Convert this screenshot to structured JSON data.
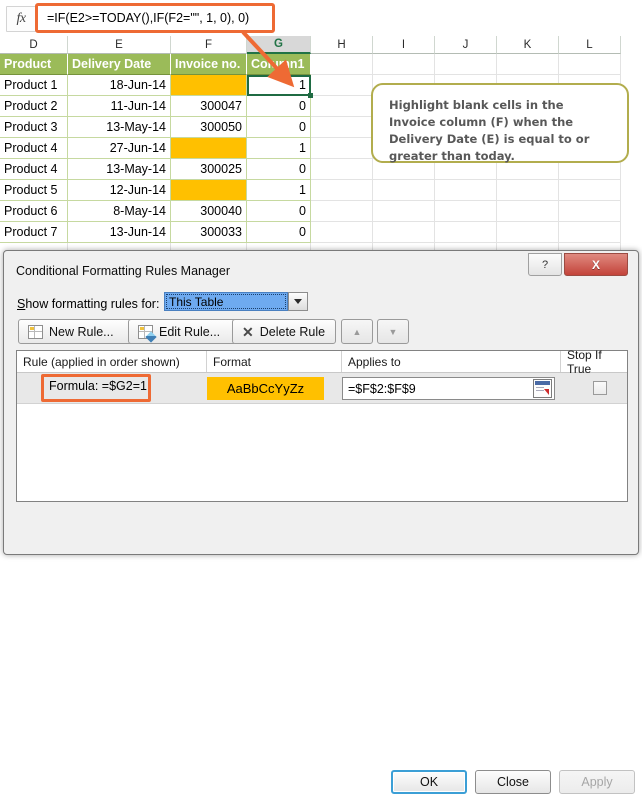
{
  "formula_bar": {
    "fx_icon": "fx-icon",
    "formula": "=IF(E2>=TODAY(),IF(F2=\"\", 1, 0), 0)"
  },
  "worksheet": {
    "column_letters": [
      "D",
      "E",
      "F",
      "G",
      "H",
      "I",
      "J",
      "K",
      "L"
    ],
    "selected_column": "G",
    "active_cell": "G2",
    "headers": [
      "Product",
      "Delivery Date",
      "Invoice no.",
      "Column1"
    ],
    "rows": [
      {
        "product": "Product 1",
        "date": "18-Jun-14",
        "invoice": "",
        "flag": "1",
        "invoice_filled": true
      },
      {
        "product": "Product 2",
        "date": "11-Jun-14",
        "invoice": "300047",
        "flag": "0",
        "invoice_filled": false
      },
      {
        "product": "Product 3",
        "date": "13-May-14",
        "invoice": "300050",
        "flag": "0",
        "invoice_filled": false
      },
      {
        "product": "Product 4",
        "date": "27-Jun-14",
        "invoice": "",
        "flag": "1",
        "invoice_filled": true
      },
      {
        "product": "Product 4",
        "date": "13-May-14",
        "invoice": "300025",
        "flag": "0",
        "invoice_filled": false
      },
      {
        "product": "Product 5",
        "date": "12-Jun-14",
        "invoice": "",
        "flag": "1",
        "invoice_filled": true
      },
      {
        "product": "Product 6",
        "date": "8-May-14",
        "invoice": "300040",
        "flag": "0",
        "invoice_filled": false
      },
      {
        "product": "Product 7",
        "date": "13-Jun-14",
        "invoice": "300033",
        "flag": "0",
        "invoice_filled": false
      }
    ]
  },
  "callout": {
    "text": "Highlight blank cells in the Invoice column (F) when the Delivery Date (E) is equal to or greater than today."
  },
  "dialog": {
    "title": "Conditional Formatting Rules Manager",
    "help_label": "?",
    "close_label": "X",
    "show_rules_label": "Show formatting rules for:",
    "scope_value": "This Table",
    "buttons": {
      "new_rule": "New Rule...",
      "edit_rule": "Edit Rule...",
      "delete_rule": "Delete Rule",
      "move_up": "▲",
      "move_down": "▼"
    },
    "grid_headers": [
      "Rule (applied in order shown)",
      "Format",
      "Applies to",
      "Stop If True"
    ],
    "rules": [
      {
        "rule": "Formula: =$G2=1",
        "format_preview": "AaBbCcYyZz",
        "applies_to": "=$F$2:$F$9",
        "stop_if_true": false
      }
    ],
    "footer": {
      "ok": "OK",
      "close": "Close",
      "apply": "Apply"
    }
  },
  "colors": {
    "table_header_green": "#9BBB59",
    "highlight_orange": "#FFC000",
    "annotation_orange": "#EE6A34",
    "callout_border": "#B2AD4D",
    "excel_green": "#217346"
  }
}
